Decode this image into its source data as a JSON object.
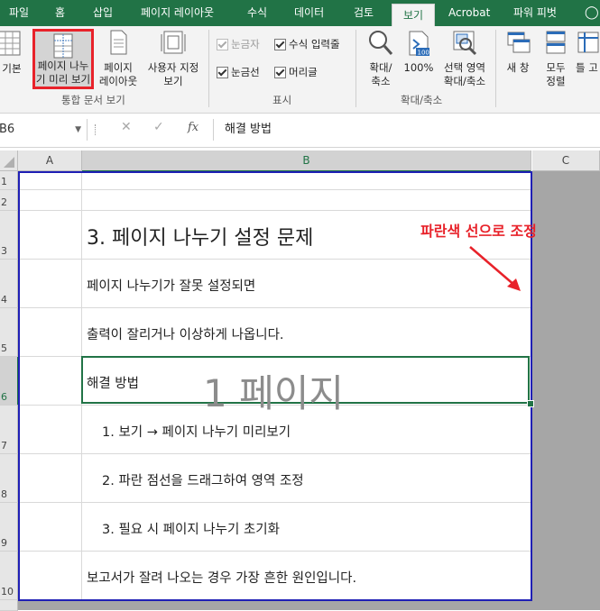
{
  "ribbon_tabs": [
    "파일",
    "홈",
    "삽입",
    "페이지 레이아웃",
    "수식",
    "데이터",
    "검토",
    "보기",
    "Acrobat",
    "파워 피벗"
  ],
  "ribbon": {
    "normal_label": "기본",
    "page_break_preview_line1": "페이지 나누",
    "page_break_preview_line2": "기 미리 보기",
    "page_layout_line1": "페이지",
    "page_layout_line2": "레이아웃",
    "custom_views_line1": "사용자 지정",
    "custom_views_line2": "보기",
    "group_workbook_views": "통합 문서 보기",
    "ruler": "눈금자",
    "formula_bar": "수식 입력줄",
    "gridlines": "눈금선",
    "headings": "머리글",
    "group_show": "표시",
    "zoom_line1": "확대/",
    "zoom_line2": "축소",
    "zoom100": "100%",
    "zoom_selection_line1": "선택 영역",
    "zoom_selection_line2": "확대/축소",
    "group_zoom": "확대/축소",
    "new_window": "새 창",
    "arrange_all_line1": "모두",
    "arrange_all_line2": "정렬",
    "freeze": "틀 고",
    "highlight_color": "#e8222a"
  },
  "formula_bar": {
    "name_box": "B6",
    "cancel": "✕",
    "enter": "✓",
    "fx": "fx",
    "content": "해결 방법"
  },
  "sheet": {
    "columns": [
      "A",
      "B",
      "C"
    ],
    "rows": [
      "1",
      "2",
      "3",
      "4",
      "5",
      "6",
      "7",
      "8",
      "9",
      "10"
    ],
    "cells": {
      "b3": "3. 페이지 나누기 설정 문제",
      "b4": "페이지 나누기가 잘못 설정되면",
      "b5": "출력이 잘리거나 이상하게 나옵니다.",
      "b6": "해결 방법",
      "b7": "1. 보기 → 페이지 나누기 미리보기",
      "b8": "2. 파란 점선을 드래그하여 영역 조정",
      "b9": "3. 필요 시 페이지 나누기 초기화",
      "b10": "보고서가 잘려 나오는 경우 가장 흔한 원인입니다."
    },
    "page_watermark": "1 페이지",
    "annotation": "파란색 선으로 조정",
    "page_border_color": "#1f1fb5",
    "annotation_color": "#e8222a",
    "outside_print_area_color": "#a6a6a6",
    "selected_color": "#217346"
  }
}
